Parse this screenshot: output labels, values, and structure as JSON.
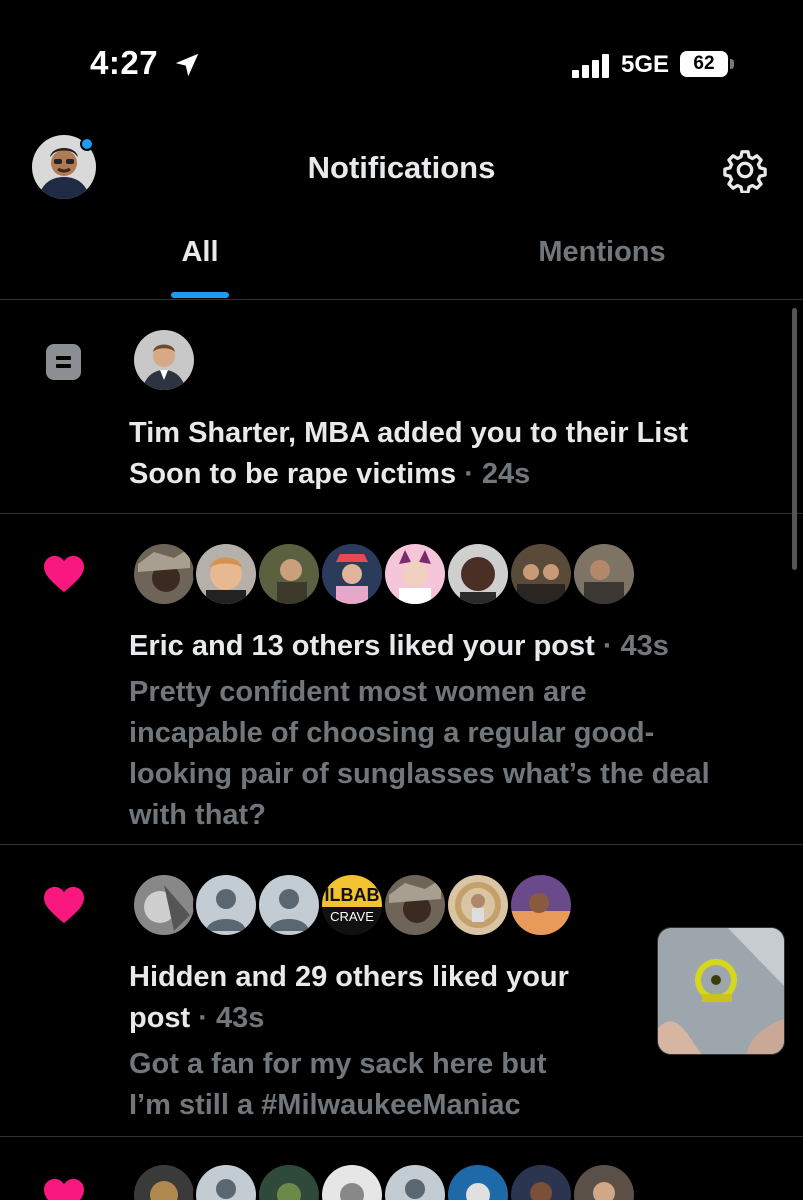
{
  "status_bar": {
    "time": "4:27",
    "network": "5GE",
    "battery": "62"
  },
  "header": {
    "title": "Notifications",
    "avatar_icon": "profile-avatar",
    "settings_icon": "gear-icon"
  },
  "tabs": [
    {
      "label": "All",
      "active": true
    },
    {
      "label": "Mentions",
      "active": false
    }
  ],
  "notifications": [
    {
      "type": "list_add",
      "icon": "list-icon",
      "line1": "Tim Sharter, MBA added you to their List",
      "line2": "Soon to be rape victims",
      "time": "· 24s"
    },
    {
      "type": "like",
      "icon": "heart-icon",
      "headline": "Eric and 13 others liked your post",
      "time": "· 43s",
      "snippet": [
        "Pretty confident most women are",
        "incapable of choosing a regular good-",
        "looking pair of sunglasses what’s the deal",
        "with that?"
      ]
    },
    {
      "type": "like",
      "icon": "heart-icon",
      "headline_line1": "Hidden and 29 others liked your",
      "headline_line2": "post",
      "time": "· 43s",
      "snippet": [
        "Got a fan for my sack here but",
        "I’m still a #MilwaukeeManiac"
      ],
      "avatar_badge_text": [
        "ILBAB",
        "CRAVE"
      ]
    },
    {
      "type": "like",
      "icon": "heart-icon"
    }
  ],
  "colors": {
    "accent": "#1d9bf0",
    "heart": "#f91880",
    "text": "#e7e9ea",
    "muted": "#71767b",
    "divider": "#2f3336"
  }
}
